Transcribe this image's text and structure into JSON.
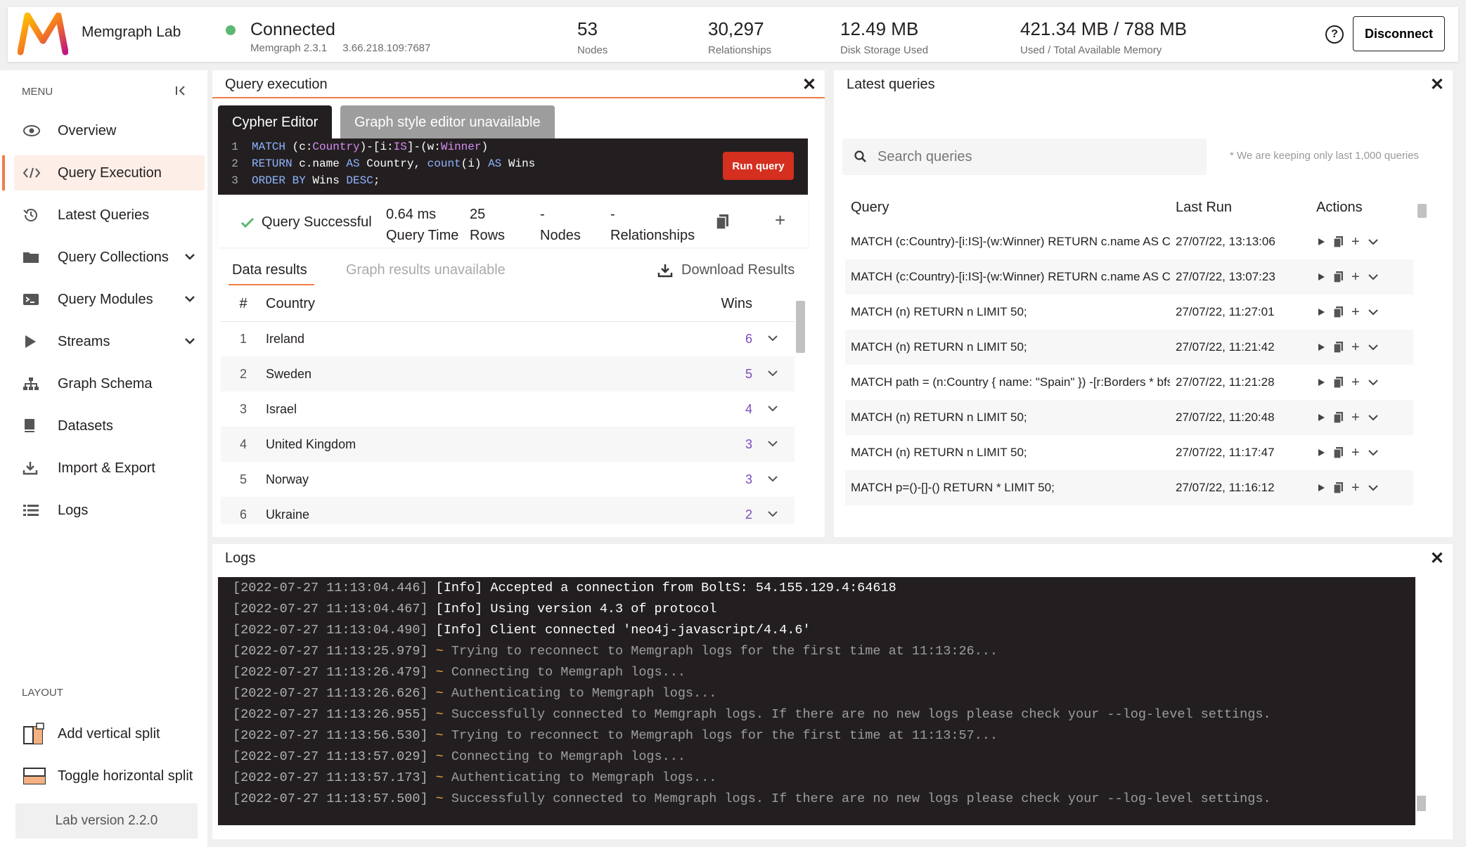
{
  "app": {
    "name": "Memgraph Lab",
    "status": "Connected",
    "version": "Memgraph 2.3.1",
    "address": "3.66.218.109:7687",
    "help": "?",
    "disconnect_label": "Disconnect",
    "status_color": "#5bb974"
  },
  "stats": [
    {
      "value": "53",
      "label": "Nodes"
    },
    {
      "value": "30,297",
      "label": "Relationships"
    },
    {
      "value": "12.49 MB",
      "label": "Disk Storage Used"
    },
    {
      "value": "421.34 MB / 788 MB",
      "label": "Used / Total Available Memory"
    }
  ],
  "sidebar": {
    "menu_title": "MENU",
    "items": [
      {
        "label": "Overview",
        "icon": "eye-icon"
      },
      {
        "label": "Query Execution",
        "icon": "code-icon"
      },
      {
        "label": "Latest Queries",
        "icon": "history-icon"
      },
      {
        "label": "Query Collections",
        "icon": "folder-icon"
      },
      {
        "label": "Query Modules",
        "icon": "terminal-icon"
      },
      {
        "label": "Streams",
        "icon": "play-icon"
      },
      {
        "label": "Graph Schema",
        "icon": "schema-icon"
      },
      {
        "label": "Datasets",
        "icon": "book-icon"
      },
      {
        "label": "Import & Export",
        "icon": "download-icon"
      },
      {
        "label": "Logs",
        "icon": "list-icon"
      }
    ],
    "layout_title": "LAYOUT",
    "layout_items": [
      {
        "label": "Add vertical split",
        "icon": "vertical-split-icon"
      },
      {
        "label": "Toggle horizontal split",
        "icon": "horizontal-split-icon"
      }
    ],
    "lab_version": "Lab version 2.2.0"
  },
  "query_exec": {
    "title": "Query execution",
    "tab_editor": "Cypher Editor",
    "tab_style": "Graph style editor unavailable",
    "run_label": "Run query",
    "status": "Query Successful",
    "time_value": "0.64 ms",
    "time_label": "Query Time",
    "rows_value": "25",
    "rows_label": "Rows",
    "nodes_value": "-",
    "nodes_label": "Nodes",
    "rels_value": "-",
    "rels_label": "Relationships",
    "subtab_data": "Data results",
    "subtab_graph": "Graph results unavailable",
    "download_label": "Download Results",
    "columns": [
      "#",
      "Country",
      "Wins"
    ],
    "rows": [
      {
        "n": "1",
        "country": "Ireland",
        "wins": "6"
      },
      {
        "n": "2",
        "country": "Sweden",
        "wins": "5"
      },
      {
        "n": "3",
        "country": "Israel",
        "wins": "4"
      },
      {
        "n": "4",
        "country": "United Kingdom",
        "wins": "3"
      },
      {
        "n": "5",
        "country": "Norway",
        "wins": "3"
      },
      {
        "n": "6",
        "country": "Ukraine",
        "wins": "2"
      }
    ]
  },
  "latest": {
    "title": "Latest queries",
    "search_placeholder": "Search queries",
    "keep_note": "* We are keeping only last 1,000 queries",
    "columns": [
      "Query",
      "Last Run",
      "Actions"
    ],
    "rows": [
      {
        "query": "MATCH (c:Country)-[i:IS]-(w:Winner) RETURN c.name AS Country, count(i) AS Wins ORDER BY Wins DESC;",
        "time": "27/07/22, 13:13:06"
      },
      {
        "query": "MATCH (c:Country)-[i:IS]-(w:Winner) RETURN c.name AS Country, count(i) AS Wins ORDER BY Wins DESC;",
        "time": "27/07/22, 13:07:23"
      },
      {
        "query": "MATCH (n) RETURN n LIMIT 50;",
        "time": "27/07/22, 11:27:01"
      },
      {
        "query": "MATCH (n) RETURN n LIMIT 50;",
        "time": "27/07/22, 11:21:42"
      },
      {
        "query": "MATCH path = (n:Country { name: \"Spain\" }) -[r:Borders * bfs]-",
        "time": "27/07/22, 11:21:28"
      },
      {
        "query": "MATCH (n) RETURN n LIMIT 50;",
        "time": "27/07/22, 11:20:48"
      },
      {
        "query": "MATCH (n) RETURN n LIMIT 50;",
        "time": "27/07/22, 11:17:47"
      },
      {
        "query": "MATCH p=()-[]-() RETURN * LIMIT 50;",
        "time": "27/07/22, 11:16:12"
      }
    ]
  },
  "logs": {
    "title": "Logs",
    "lines": [
      {
        "ts": "[2022-07-27 11:13:04.446]",
        "level": "[Info]",
        "msg": "Accepted a connection from BoltS: 54.155.129.4:64618"
      },
      {
        "ts": "[2022-07-27 11:13:04.467]",
        "level": "[Info]",
        "msg": "Using version 4.3 of protocol"
      },
      {
        "ts": "[2022-07-27 11:13:04.490]",
        "level": "[Info]",
        "msg": "Client connected 'neo4j-javascript/4.4.6'"
      },
      {
        "ts": "[2022-07-27 11:13:25.979]",
        "level": "~",
        "msg": "Trying to reconnect to Memgraph logs for the first time at 11:13:26..."
      },
      {
        "ts": "[2022-07-27 11:13:26.479]",
        "level": "~",
        "msg": "Connecting to Memgraph logs..."
      },
      {
        "ts": "[2022-07-27 11:13:26.626]",
        "level": "~",
        "msg": "Authenticating to Memgraph logs..."
      },
      {
        "ts": "[2022-07-27 11:13:26.955]",
        "level": "~",
        "msg": "Successfully connected to Memgraph logs. If there are no new logs please check your --log-level settings."
      },
      {
        "ts": "[2022-07-27 11:13:56.530]",
        "level": "~",
        "msg": "Trying to reconnect to Memgraph logs for the first time at 11:13:57..."
      },
      {
        "ts": "[2022-07-27 11:13:57.029]",
        "level": "~",
        "msg": "Connecting to Memgraph logs..."
      },
      {
        "ts": "[2022-07-27 11:13:57.173]",
        "level": "~",
        "msg": "Authenticating to Memgraph logs..."
      },
      {
        "ts": "[2022-07-27 11:13:57.500]",
        "level": "~",
        "msg": "Successfully connected to Memgraph logs. If there are no new logs please check your --log-level settings."
      }
    ]
  }
}
